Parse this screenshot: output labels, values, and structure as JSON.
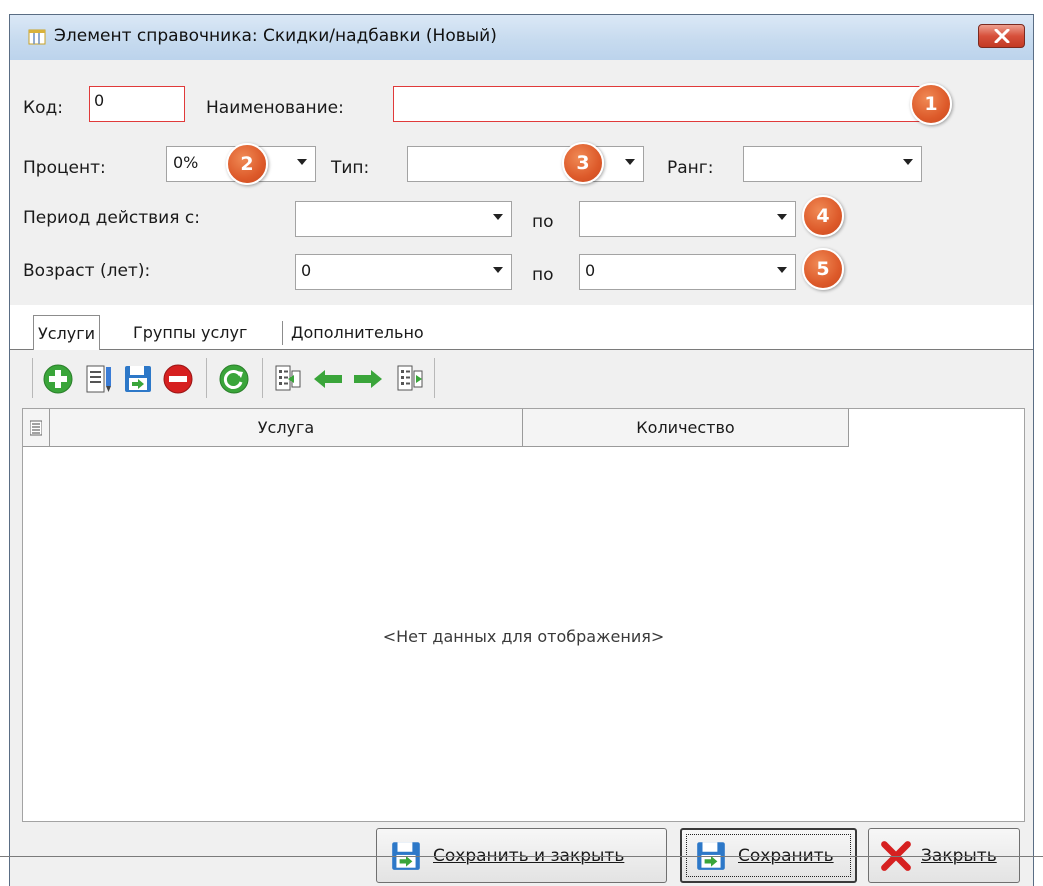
{
  "window": {
    "title": "Элемент справочника: Скидки/надбавки (Новый)"
  },
  "form": {
    "code_label": "Код:",
    "code_value": "0",
    "name_label": "Наименование:",
    "name_value": "",
    "percent_label": "Процент:",
    "percent_value": "0%",
    "type_label": "Тип:",
    "type_value": "",
    "rank_label": "Ранг:",
    "rank_value": "",
    "period_label": "Период действия с:",
    "period_from_value": "",
    "period_to_label": "по",
    "period_to_value": "",
    "age_label": "Возраст (лет):",
    "age_from_value": "0",
    "age_to_label": "по",
    "age_to_value": "0"
  },
  "markers": [
    "1",
    "2",
    "3",
    "4",
    "5"
  ],
  "tabs": [
    {
      "label": "Услуги",
      "active": true
    },
    {
      "label": "Группы услуг",
      "active": false
    },
    {
      "label": "Дополнительно",
      "active": false
    }
  ],
  "toolbar_icons": [
    "add-icon",
    "edit-icon",
    "save-icon",
    "delete-icon",
    "refresh-icon",
    "list-import-icon",
    "arrow-left-icon",
    "arrow-right-icon",
    "list-export-icon"
  ],
  "grid": {
    "columns": [
      "Услуга",
      "Количество"
    ],
    "rows": [],
    "empty_text": "<Нет данных для отображения>"
  },
  "buttons": {
    "save_close": "Сохранить и закрыть",
    "save": "Сохранить",
    "close": "Закрыть"
  },
  "colors": {
    "marker": "#dd5a2a",
    "required_border": "#e03a3a",
    "icon_green": "#3aa53a",
    "icon_red": "#d62020"
  }
}
